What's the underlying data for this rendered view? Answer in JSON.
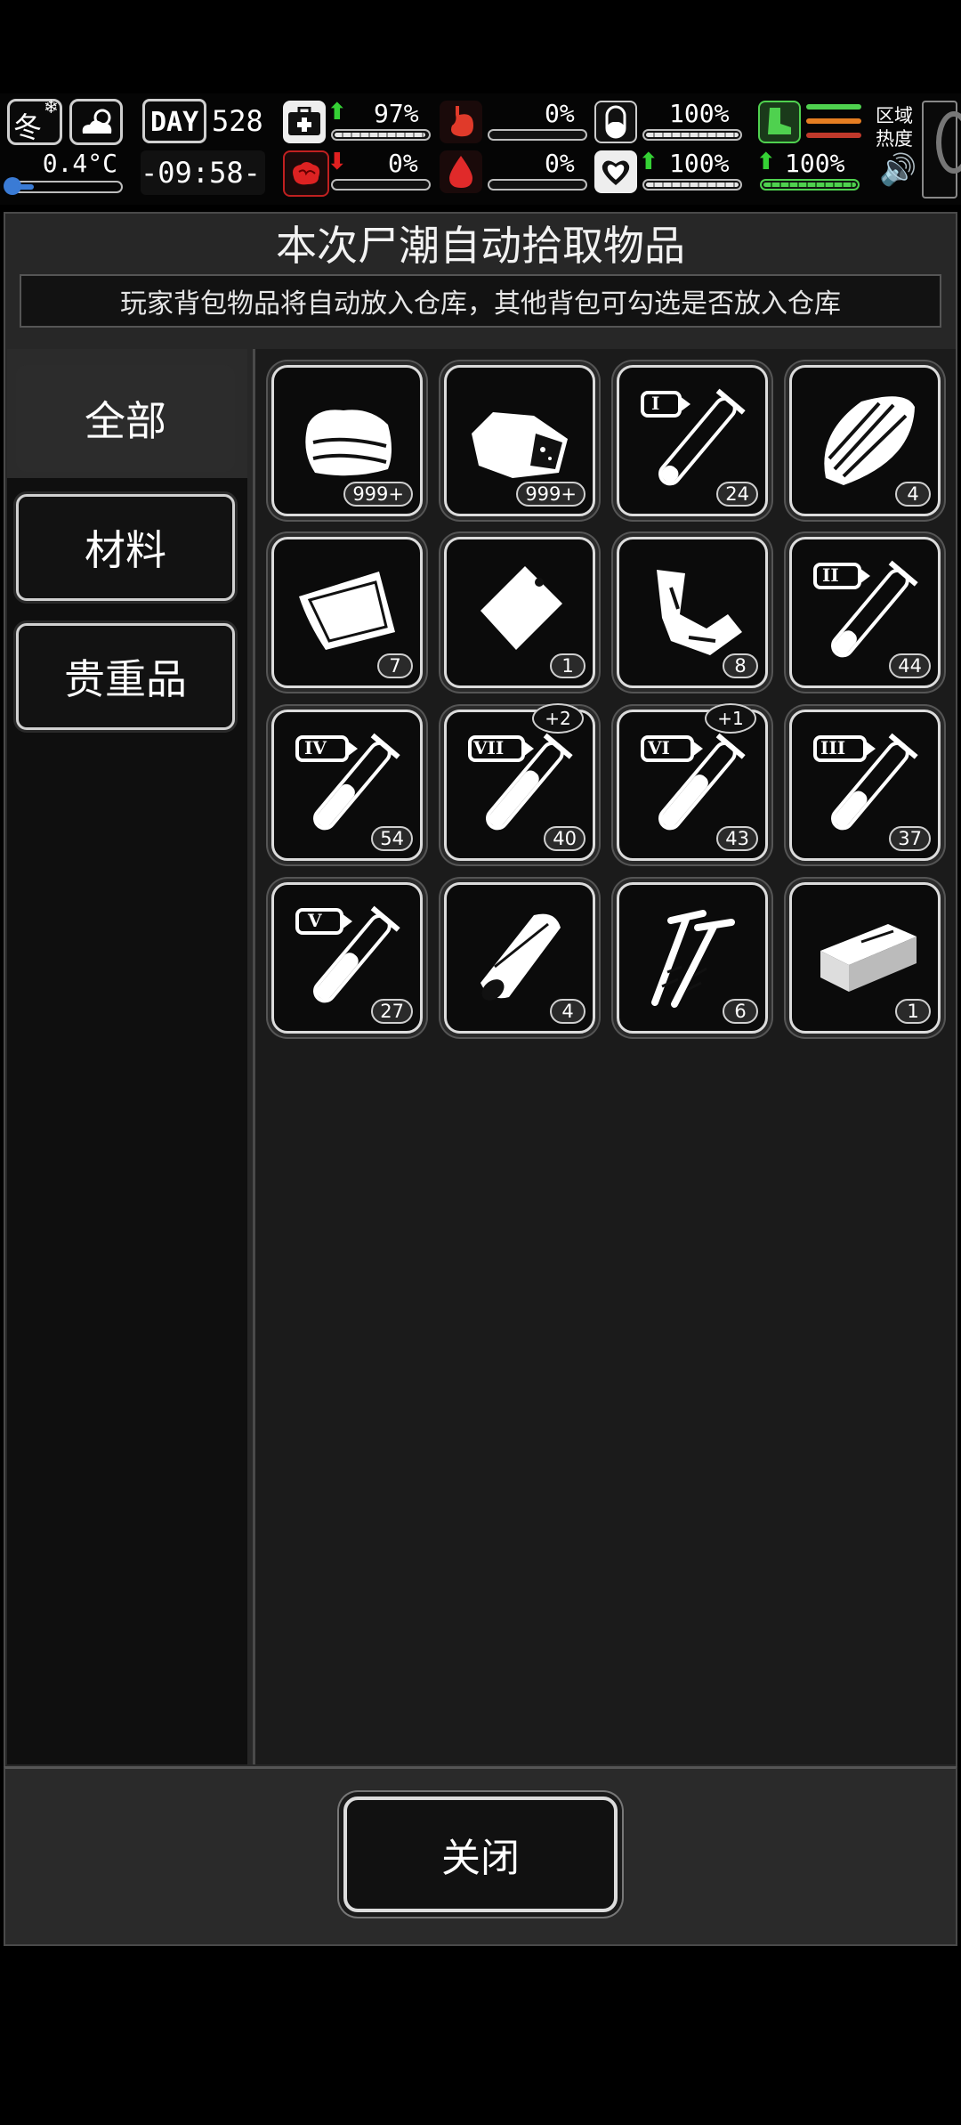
{
  "status": {
    "season": "冬",
    "temperature": "0.4°C",
    "day_label": "DAY",
    "day_number": "528",
    "time": "-09:58-",
    "health_pct": "97%",
    "stomach_pct": "0%",
    "pill_pct": "100%",
    "brain_pct": "0%",
    "blood_pct": "0%",
    "heart_pct": "100%",
    "stamina_pct": "100%",
    "region_heat_label": "区域热度",
    "colors": {
      "green": "#35d135",
      "red": "#e02020"
    }
  },
  "dialog": {
    "title": "本次尸潮自动拾取物品",
    "subtitle": "玩家背包物品将自动放入仓库，其他背包可勾选是否放入仓库"
  },
  "categories": [
    {
      "label": "全部",
      "active": true
    },
    {
      "label": "材料",
      "active": false
    },
    {
      "label": "贵重品",
      "active": false
    }
  ],
  "items": [
    {
      "icon": "cloth-icon",
      "count": "999+"
    },
    {
      "icon": "ore-rock-icon",
      "count": "999+"
    },
    {
      "icon": "test-tube-I-icon",
      "roman": "I",
      "count": "24"
    },
    {
      "icon": "wood-planks-icon",
      "count": "4"
    },
    {
      "icon": "bandage-patch-icon",
      "count": "7"
    },
    {
      "icon": "plastic-bag-icon",
      "count": "1"
    },
    {
      "icon": "scrap-parts-icon",
      "count": "8"
    },
    {
      "icon": "test-tube-II-icon",
      "roman": "II",
      "count": "44"
    },
    {
      "icon": "test-tube-IV-icon",
      "roman": "IV",
      "count": "54"
    },
    {
      "icon": "test-tube-VII-icon",
      "roman": "VII",
      "count": "40",
      "bonus": "+2"
    },
    {
      "icon": "test-tube-VI-icon",
      "roman": "VI",
      "count": "43",
      "bonus": "+1"
    },
    {
      "icon": "test-tube-III-icon",
      "roman": "III",
      "count": "37"
    },
    {
      "icon": "test-tube-V-icon",
      "roman": "V",
      "count": "27"
    },
    {
      "icon": "fabric-roll-icon",
      "count": "4"
    },
    {
      "icon": "screws-icon",
      "count": "6"
    },
    {
      "icon": "brick-icon",
      "count": "1"
    }
  ],
  "close_label": "关闭"
}
